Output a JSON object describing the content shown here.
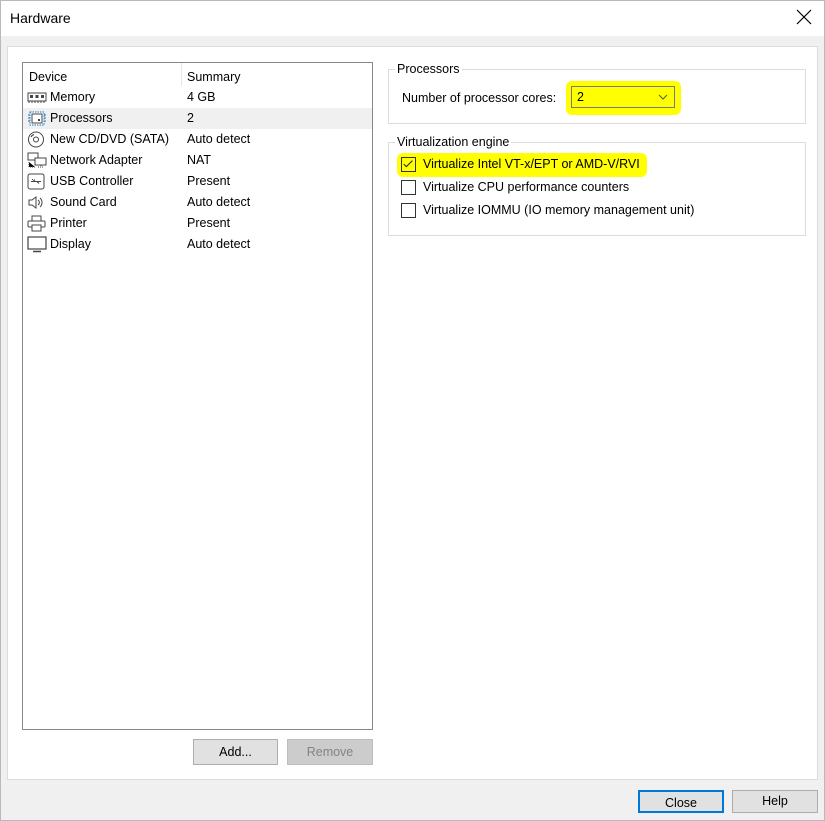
{
  "window": {
    "title": "Hardware"
  },
  "device_list": {
    "columns": [
      "Device",
      "Summary"
    ],
    "items": [
      {
        "icon": "memory-icon",
        "name": "Memory",
        "summary": "4 GB",
        "selected": false
      },
      {
        "icon": "processor-icon",
        "name": "Processors",
        "summary": "2",
        "selected": true
      },
      {
        "icon": "cd-dvd-icon",
        "name": "New CD/DVD (SATA)",
        "summary": "Auto detect",
        "selected": false
      },
      {
        "icon": "network-adapter-icon",
        "name": "Network Adapter",
        "summary": "NAT",
        "selected": false
      },
      {
        "icon": "usb-icon",
        "name": "USB Controller",
        "summary": "Present",
        "selected": false
      },
      {
        "icon": "speaker-icon",
        "name": "Sound Card",
        "summary": "Auto detect",
        "selected": false
      },
      {
        "icon": "printer-icon",
        "name": "Printer",
        "summary": "Present",
        "selected": false
      },
      {
        "icon": "display-icon",
        "name": "Display",
        "summary": "Auto detect",
        "selected": false
      }
    ],
    "add_label": "Add...",
    "remove_label": "Remove"
  },
  "processors": {
    "group_label": "Processors",
    "cores_label": "Number of processor cores:",
    "cores_value": "2"
  },
  "virtualization": {
    "group_label": "Virtualization engine",
    "options": [
      {
        "label": "Virtualize Intel VT-x/EPT or AMD-V/RVI",
        "checked": true
      },
      {
        "label": "Virtualize CPU performance counters",
        "checked": false
      },
      {
        "label": "Virtualize IOMMU (IO memory management unit)",
        "checked": false
      }
    ]
  },
  "footer": {
    "close_label": "Close",
    "help_label": "Help"
  },
  "colors": {
    "highlight": "#ffff00",
    "default_button_border": "#0078d7",
    "selected_row": "#f0f0f0"
  }
}
